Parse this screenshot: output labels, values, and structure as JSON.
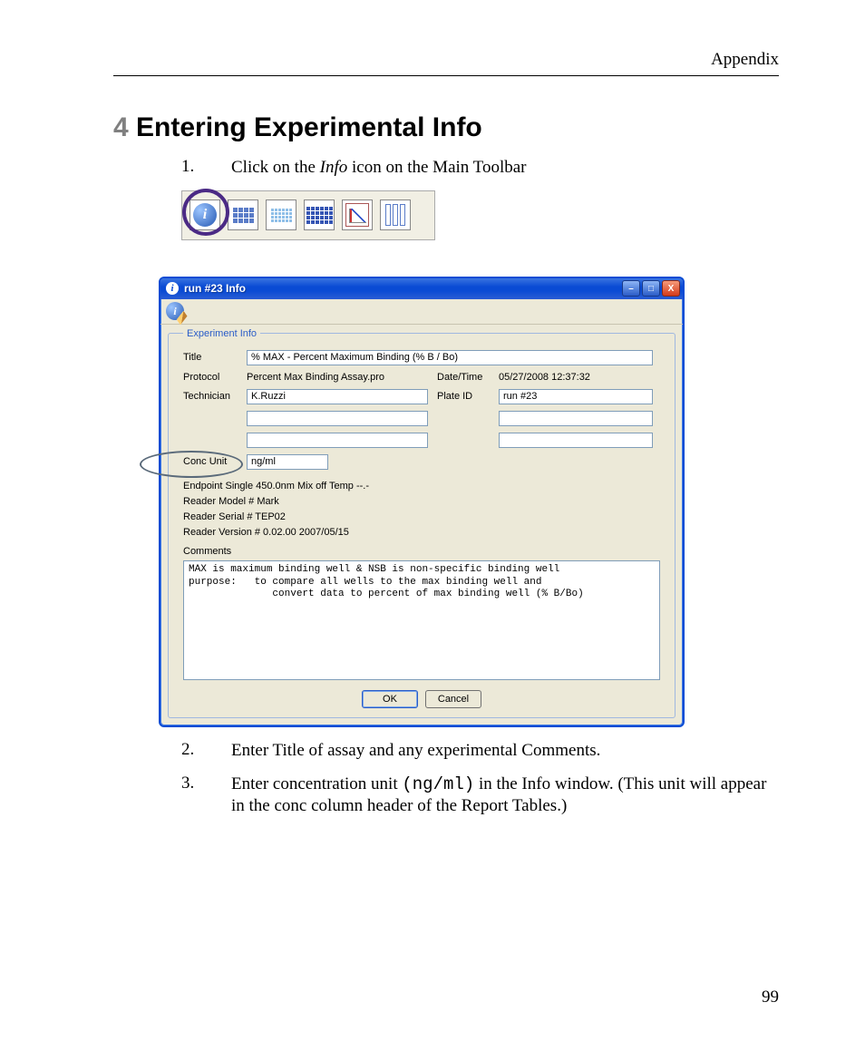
{
  "header": {
    "section": "Appendix"
  },
  "title": {
    "number": "4",
    "text": "Entering Experimental Info"
  },
  "steps": [
    {
      "n": "1.",
      "before": "Click on the ",
      "italic": "Info",
      "after": " icon on the Main Toolbar"
    },
    {
      "n": "2.",
      "text": "Enter Title of assay and any experimental Comments."
    },
    {
      "n": "3.",
      "before": "Enter concentration unit ",
      "mono": "(ng/ml)",
      "after": " in the Info window. (This unit will appear in the conc column header of the Report Tables.)"
    }
  ],
  "toolbar_icons": [
    "info-icon",
    "grid-basic-icon",
    "grid-light-icon",
    "grid-dense-icon",
    "chart-icon",
    "columns-icon"
  ],
  "dialog": {
    "window_title": "run #23  Info",
    "group_legend": "Experiment Info",
    "labels": {
      "title": "Title",
      "protocol": "Protocol",
      "datetime": "Date/Time",
      "technician": "Technician",
      "plate_id": "Plate ID",
      "conc_unit": "Conc Unit",
      "comments": "Comments"
    },
    "values": {
      "title": "% MAX - Percent Maximum Binding (% B / Bo)",
      "protocol": "Percent Max Binding Assay.pro",
      "datetime": "05/27/2008 12:37:32",
      "technician": "K.Ruzzi",
      "plate_id": "run #23",
      "extra_left_1": "",
      "extra_right_1": "",
      "extra_left_2": "",
      "extra_right_2": "",
      "conc_unit": "ng/ml"
    },
    "status": {
      "line1": "Endpoint Single 450.0nm  Mix off Temp --.-",
      "line2": "Reader Model # Mark",
      "line3": "Reader Serial # TEP02",
      "line4": "Reader Version # 0.02.00 2007/05/15"
    },
    "comments_text": "MAX is maximum binding well & NSB is non-specific binding well\npurpose:   to compare all wells to the max binding well and\n              convert data to percent of max binding well (% B/Bo)",
    "buttons": {
      "ok": "OK",
      "cancel": "Cancel"
    },
    "win_buttons": {
      "min": "–",
      "max": "□",
      "close": "X"
    }
  },
  "page_number": "99"
}
